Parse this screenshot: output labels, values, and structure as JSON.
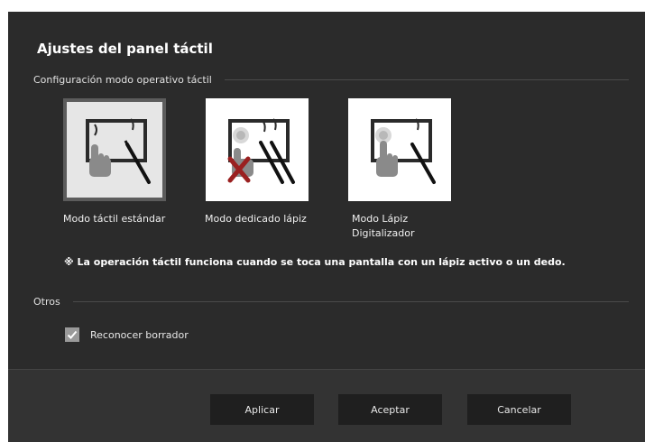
{
  "dialog": {
    "title": "Ajustes del panel táctil"
  },
  "touch_mode_section": {
    "heading": "Configuración modo operativo táctil",
    "modes": [
      {
        "label": "Modo táctil estándar",
        "icon": "touch-and-pen-icon",
        "selected": true
      },
      {
        "label": "Modo dedicado lápiz",
        "icon": "pen-only-icon",
        "selected": false
      },
      {
        "label": "Modo Lápiz Digitalizador",
        "icon": "digitizer-pen-icon",
        "selected": false
      }
    ],
    "note": "※ La operación táctil funciona cuando se toca una pantalla con un lápiz activo o un dedo."
  },
  "others_section": {
    "heading": "Otros",
    "eraser_checkbox": {
      "label": "Reconocer borrador",
      "checked": true
    }
  },
  "footer": {
    "apply_label": "Aplicar",
    "accept_label": "Aceptar",
    "cancel_label": "Cancelar"
  },
  "colors": {
    "dialog_background": "#2b2b2b",
    "footer_background": "#333333",
    "button_background": "#1f1f1f",
    "checkbox_fill": "#9a9a9a"
  }
}
